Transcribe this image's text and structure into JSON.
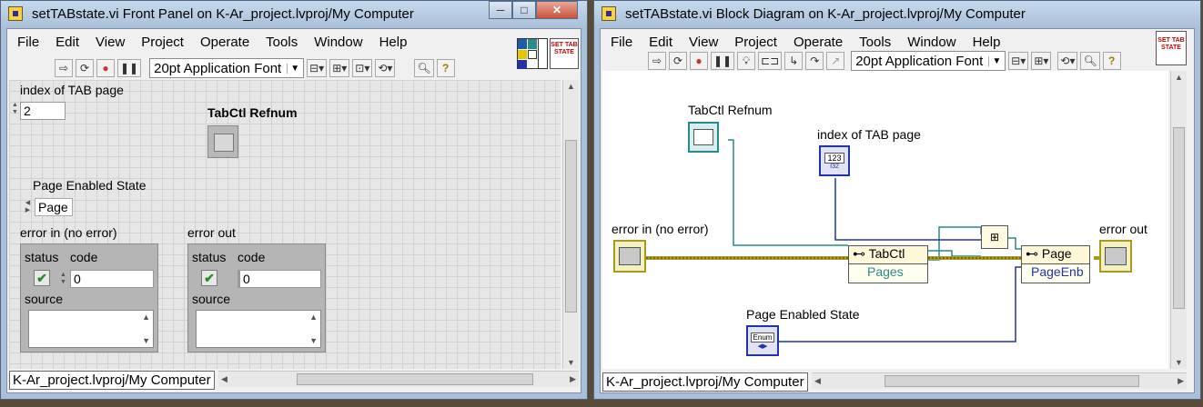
{
  "front_panel": {
    "title": "setTABstate.vi Front Panel on K-Ar_project.lvproj/My Computer",
    "menu": [
      "File",
      "Edit",
      "View",
      "Project",
      "Operate",
      "Tools",
      "Window",
      "Help"
    ],
    "font_label": "20pt Application Font",
    "index_label": "index of TAB page",
    "index_value": "2",
    "refnum_label": "TabCtl Refnum",
    "page_state_label": "Page Enabled State",
    "page_state_value": "Page",
    "error_in_label": "error in (no error)",
    "error_out_label": "error out",
    "status_label": "status",
    "code_label": "code",
    "source_label": "source",
    "error_in_code": "0",
    "error_out_code": "0",
    "status_bar": "K-Ar_project.lvproj/My Computer",
    "vi_icon_text": "SET TAB STATE"
  },
  "block_diagram": {
    "title": "setTABstate.vi Block Diagram on K-Ar_project.lvproj/My Computer",
    "menu": [
      "File",
      "Edit",
      "View",
      "Project",
      "Operate",
      "Tools",
      "Window",
      "Help"
    ],
    "font_label": "20pt Application Font",
    "refnum_label": "TabCtl Refnum",
    "index_label": "index of TAB page",
    "error_in_label": "error in (no error)",
    "error_out_label": "error out",
    "page_state_label": "Page Enabled State",
    "prop_node1_header": "TabCtl",
    "prop_node1_item": "Pages",
    "prop_node2_header": "Page",
    "prop_node2_item": "PageEnb",
    "index_terminal_text": "123",
    "index_terminal_sub": "I32",
    "enum_terminal_text": "Enum",
    "status_bar": "K-Ar_project.lvproj/My Computer",
    "vi_icon_text": "SET TAB STATE"
  },
  "colors": {
    "wire_ref": "#2a8a8a",
    "wire_int": "#2233aa",
    "wire_error": "#a89a20"
  }
}
